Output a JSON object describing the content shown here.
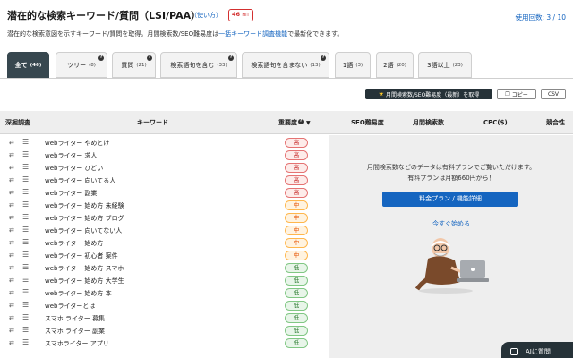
{
  "header": {
    "title": "潜在的な検索キーワード/質問（LSI/PAA）",
    "howto": "（使い方）",
    "hit_count": "46",
    "hit_unit": "HIT",
    "usage": "使用回数: 3 / 10"
  },
  "description": {
    "before": "潜在的な検索意図を示すキーワード/質問を取得。月間検索数/SEO難易度は",
    "link": "一括キーワード調査機能",
    "after": "で最新化できます。"
  },
  "tabs": [
    {
      "label": "全て",
      "count": "(46)"
    },
    {
      "label": "ツリー",
      "count": "(8)"
    },
    {
      "label": "質問",
      "count": "(21)"
    },
    {
      "label": "検索語句を含む",
      "count": "(33)"
    },
    {
      "label": "検索語句を含まない",
      "count": "(13)"
    },
    {
      "label": "1語",
      "count": "(3)"
    },
    {
      "label": "2語",
      "count": "(20)"
    },
    {
      "label": "3語以上",
      "count": "(23)"
    }
  ],
  "actions": {
    "update": "月間検索数/SEO難易度（最新）を取得",
    "copy": "コピー",
    "csv": "CSV"
  },
  "columns": {
    "research": "深掘調査",
    "keyword": "キーワード",
    "importance": "重要度",
    "seo": "SEO難易度",
    "volume": "月間検索数",
    "cpc": "CPC($)",
    "competition": "競合性"
  },
  "rows": [
    {
      "keyword": "webライター やめとけ",
      "importance": "高",
      "level": "high"
    },
    {
      "keyword": "webライター 求人",
      "importance": "高",
      "level": "high"
    },
    {
      "keyword": "webライター ひどい",
      "importance": "高",
      "level": "high"
    },
    {
      "keyword": "webライター 向いてる人",
      "importance": "高",
      "level": "high"
    },
    {
      "keyword": "webライター 副業",
      "importance": "高",
      "level": "high"
    },
    {
      "keyword": "webライター 始め方 未経験",
      "importance": "中",
      "level": "mid"
    },
    {
      "keyword": "webライター 始め方 ブログ",
      "importance": "中",
      "level": "mid"
    },
    {
      "keyword": "webライター 向いてない人",
      "importance": "中",
      "level": "mid"
    },
    {
      "keyword": "webライター 始め方",
      "importance": "中",
      "level": "mid"
    },
    {
      "keyword": "webライター 初心者 案件",
      "importance": "中",
      "level": "mid"
    },
    {
      "keyword": "webライター 始め方 スマホ",
      "importance": "低",
      "level": "low"
    },
    {
      "keyword": "webライター 始め方 大学生",
      "importance": "低",
      "level": "low"
    },
    {
      "keyword": "webライター 始め方 本",
      "importance": "低",
      "level": "low"
    },
    {
      "keyword": "webライターとは",
      "importance": "低",
      "level": "low"
    },
    {
      "keyword": "スマホ ライター 募集",
      "importance": "低",
      "level": "low"
    },
    {
      "keyword": "スマホ ライター 副業",
      "importance": "低",
      "level": "low"
    },
    {
      "keyword": "スマホライター アプリ",
      "importance": "低",
      "level": "low"
    }
  ],
  "panel": {
    "line1": "月間検索数などのデータは有料プランでご覧いただけます。",
    "line2": "有料プランは月額660円から！",
    "plan_button": "料金プラン / 機能詳細",
    "start_link": "今すぐ始める"
  },
  "ai_button": "AIに質問",
  "colors": {
    "accent": "#1565c0",
    "active_tab": "#37474f",
    "high": "#c62828",
    "mid": "#e65100",
    "low": "#2e7d32"
  }
}
